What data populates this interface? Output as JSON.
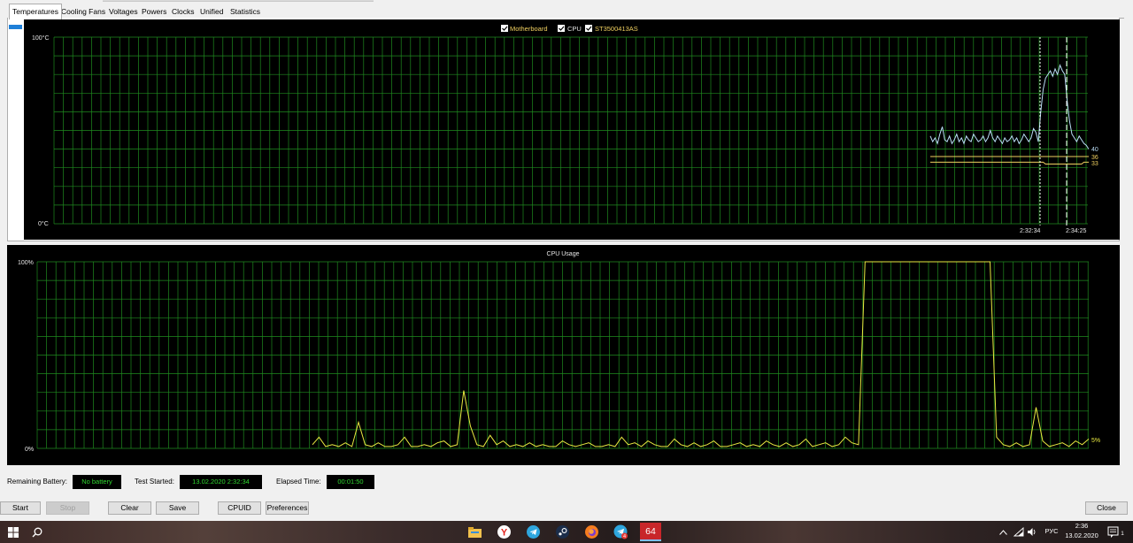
{
  "tabs": [
    "Temperatures",
    "Cooling Fans",
    "Voltages",
    "Powers",
    "Clocks",
    "Unified",
    "Statistics"
  ],
  "temperature_chart": {
    "legend": [
      {
        "label": "Motherboard",
        "checked": true,
        "color": "#f0d060"
      },
      {
        "label": "CPU",
        "checked": true,
        "color": "#e6e6e6"
      },
      {
        "label": "ST3500413AS",
        "checked": true,
        "color": "#f0d060"
      }
    ],
    "y_top_label": "100°C",
    "y_bottom_label": "0°C",
    "time_marker_1": "2:32:34",
    "time_marker_2": "2:34:25",
    "value_cpu": "40",
    "value_motherboard": "36",
    "value_disk": "33"
  },
  "chart_data": [
    {
      "type": "line",
      "ylim": [
        0,
        100
      ],
      "y_tick_labels": [
        "100°C",
        "0°C"
      ],
      "x_tick_labels": [
        "2:32:34",
        "2:34:25"
      ],
      "legend": [
        "Motherboard",
        "CPU",
        "ST3500413AS"
      ],
      "series": [
        {
          "name": "CPU",
          "color": "#b8dcf4",
          "values": [
            47,
            44,
            46,
            43,
            48,
            52,
            45,
            44,
            47,
            43,
            45,
            48,
            44,
            46,
            43,
            47,
            45,
            44,
            48,
            46,
            44,
            45,
            47,
            44,
            46,
            50,
            46,
            44,
            47,
            45,
            43,
            46,
            44,
            45,
            47,
            44,
            46,
            43,
            45,
            48,
            46,
            44,
            46,
            51,
            49,
            44,
            60,
            72,
            78,
            80,
            82,
            79,
            83,
            80,
            85,
            82,
            80,
            66,
            55,
            48,
            46,
            44,
            47,
            45,
            43,
            42,
            40
          ]
        },
        {
          "name": "Motherboard",
          "color": "#f0d060",
          "values": [
            36,
            36,
            36,
            36,
            36,
            36,
            36,
            36,
            36,
            36,
            36,
            36,
            36,
            36,
            36,
            36,
            36,
            36,
            36,
            36,
            36,
            36,
            36,
            36,
            36,
            36,
            36,
            36,
            36,
            36,
            36,
            36,
            36,
            36,
            36,
            36,
            36,
            36,
            36,
            36,
            36,
            36,
            36,
            36,
            36,
            36,
            36,
            36,
            36,
            36,
            36,
            36,
            36,
            36,
            36,
            36,
            36,
            36,
            36,
            36,
            36,
            36,
            36,
            36,
            36,
            36,
            36
          ]
        },
        {
          "name": "ST3500413AS",
          "color": "#f0d060",
          "values": [
            33,
            33,
            33,
            33,
            33,
            33,
            33,
            33,
            33,
            33,
            33,
            33,
            33,
            33,
            33,
            33,
            33,
            33,
            33,
            33,
            33,
            33,
            33,
            33,
            33,
            33,
            33,
            33,
            33,
            33,
            33,
            33,
            33,
            33,
            33,
            33,
            33,
            33,
            33,
            33,
            33,
            33,
            33,
            33,
            33,
            33,
            33,
            33,
            32,
            32,
            32,
            32,
            32,
            32,
            32,
            32,
            32,
            32,
            32,
            32,
            32,
            32,
            32,
            32,
            33,
            33,
            33
          ]
        }
      ]
    },
    {
      "type": "line",
      "title": "CPU Usage",
      "ylim": [
        0,
        100
      ],
      "y_tick_labels": [
        "100%",
        "0%"
      ],
      "series": [
        {
          "name": "CPU Usage",
          "color": "#e8e840",
          "values": [
            2,
            6,
            1,
            2,
            1,
            3,
            1,
            14,
            2,
            1,
            3,
            1,
            1,
            2,
            6,
            1,
            1,
            2,
            1,
            3,
            4,
            1,
            2,
            31,
            12,
            2,
            1,
            7,
            2,
            4,
            1,
            2,
            1,
            3,
            1,
            2,
            1,
            1,
            4,
            2,
            1,
            2,
            3,
            1,
            1,
            2,
            1,
            6,
            2,
            3,
            1,
            4,
            2,
            1,
            1,
            5,
            2,
            1,
            3,
            1,
            2,
            4,
            1,
            1,
            2,
            3,
            1,
            2,
            1,
            4,
            2,
            1,
            3,
            1,
            2,
            5,
            1,
            2,
            3,
            1,
            2,
            6,
            3,
            2,
            100,
            100,
            100,
            100,
            100,
            100,
            100,
            100,
            100,
            100,
            100,
            100,
            100,
            100,
            100,
            100,
            100,
            100,
            100,
            100,
            6,
            2,
            1,
            3,
            1,
            2,
            22,
            4,
            1,
            2,
            3,
            1,
            4,
            2,
            5
          ]
        }
      ]
    }
  ],
  "cpu_chart": {
    "title": "CPU Usage",
    "y_top_label": "100%",
    "y_bottom_label": "0%",
    "current_value": "5%"
  },
  "status": {
    "battery_label": "Remaining Battery:",
    "battery_value": "No battery",
    "started_label": "Test Started:",
    "started_value": "13.02.2020 2:32:34",
    "elapsed_label": "Elapsed Time:",
    "elapsed_value": "00:01:50"
  },
  "buttons": {
    "start": "Start",
    "stop": "Stop",
    "clear": "Clear",
    "save": "Save",
    "cpuid": "CPUID",
    "preferences": "Preferences",
    "close": "Close"
  },
  "taskbar": {
    "badge_text": "64",
    "telegram_badge": "4",
    "lang": "РУС",
    "time": "2:36",
    "date": "13.02.2020",
    "notification_count": "1"
  }
}
